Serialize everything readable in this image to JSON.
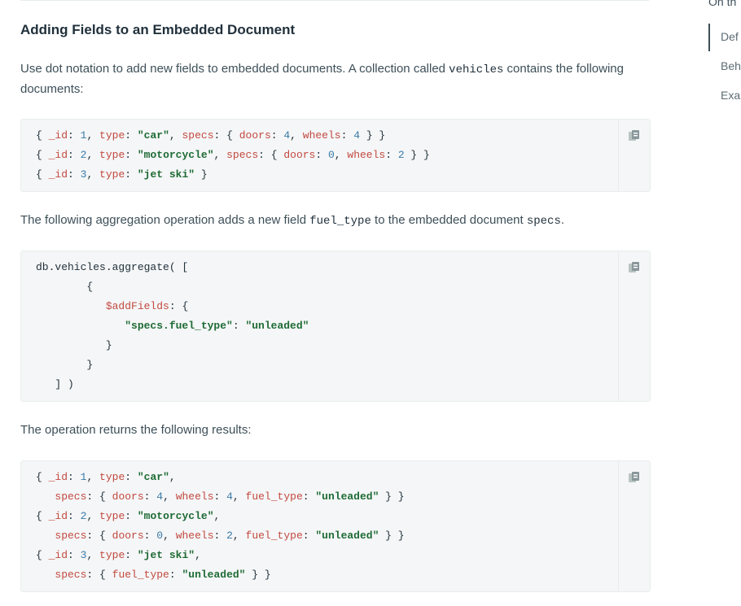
{
  "section": {
    "heading": "Adding Fields to an Embedded Document"
  },
  "intro": {
    "text_before": "Use dot notation to add new fields to embedded documents. A collection called ",
    "code": "vehicles",
    "text_after": " contains the following documents:"
  },
  "code1": {
    "lines": [
      "{ _id: 1, type: \"car\", specs: { doors: 4, wheels: 4 } }",
      "{ _id: 2, type: \"motorcycle\", specs: { doors: 0, wheels: 2 } }",
      "{ _id: 3, type: \"jet ski\" }"
    ]
  },
  "para2": {
    "text_before": "The following aggregation operation adds a new field ",
    "code1": "fuel_type",
    "text_mid": " to the embedded document ",
    "code2": "specs",
    "text_after": "."
  },
  "code2": {
    "lines": [
      "db.vehicles.aggregate( [",
      "        {",
      "           $addFields: {",
      "              \"specs.fuel_type\": \"unleaded\"",
      "           }",
      "        }",
      "   ] )"
    ]
  },
  "para3": {
    "text": "The operation returns the following results:"
  },
  "code3": {
    "lines": [
      "{ _id: 1, type: \"car\",",
      "   specs: { doors: 4, wheels: 4, fuel_type: \"unleaded\" } }",
      "{ _id: 2, type: \"motorcycle\",",
      "   specs: { doors: 0, wheels: 2, fuel_type: \"unleaded\" } }",
      "{ _id: 3, type: \"jet ski\",",
      "   specs: { fuel_type: \"unleaded\" } }"
    ]
  },
  "copy_icon": "copy-icon",
  "toc": {
    "title": "On th",
    "items": [
      "Def",
      "Beh",
      "Exa"
    ]
  }
}
